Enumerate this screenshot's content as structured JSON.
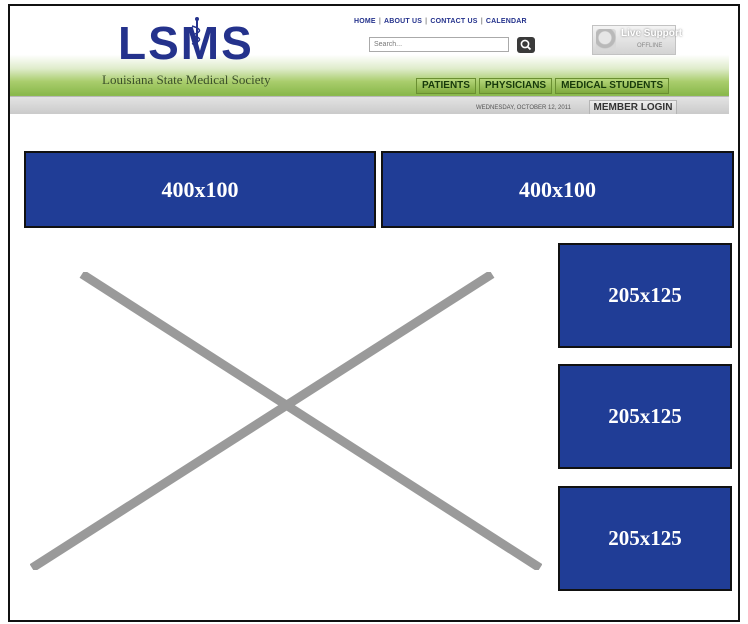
{
  "colors": {
    "banner_blue": "#203d96",
    "logo_blue": "#24328c",
    "nav_green": "#8ab94c",
    "placeholder_grey": "#9a9a9a"
  },
  "header": {
    "logo_text": "LSMS",
    "logo_subtitle": "Louisiana State Medical Society",
    "top_links": [
      "HOME",
      "ABOUT US",
      "CONTACT US",
      "CALENDAR"
    ],
    "search_placeholder": "Search...",
    "search_icon": "search-icon",
    "live_support": {
      "title": "Live Support",
      "status": "OFFLINE"
    },
    "nav_tabs": [
      "PATIENTS",
      "PHYSICIANS",
      "MEDICAL STUDENTS"
    ],
    "date": "WEDNESDAY, OCTOBER 12, 2011",
    "member_login": "MEMBER LOGIN"
  },
  "ads": {
    "top_left": "400x100",
    "top_right": "400x100",
    "side": [
      "205x125",
      "205x125",
      "205x125"
    ]
  },
  "main_image": {
    "icon": "image-placeholder-x-icon"
  }
}
